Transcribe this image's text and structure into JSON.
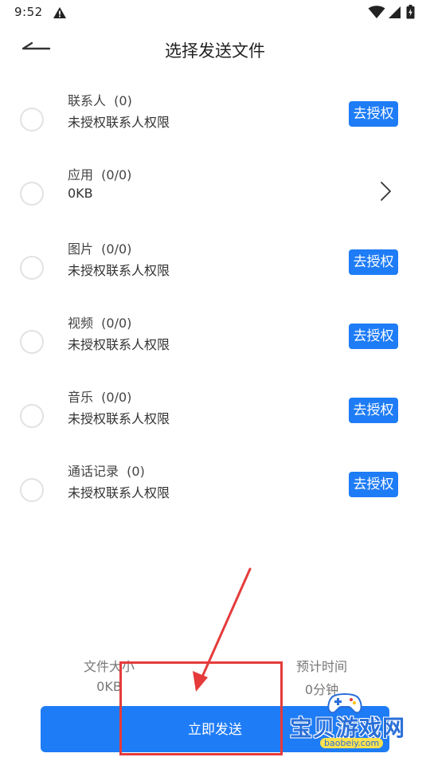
{
  "status_bar": {
    "time": "9:52",
    "icons": [
      "warning-icon",
      "wifi-icon",
      "signal-icon",
      "battery-icon"
    ]
  },
  "header": {
    "back_icon": "back-arrow-icon",
    "title": "选择发送文件"
  },
  "items": [
    {
      "title": "联系人  (0)",
      "subtitle": "未授权联系人权限",
      "action": "去授权"
    },
    {
      "title": "应用  (0/0)",
      "subtitle": "0KB",
      "action": "chevron-right-icon"
    },
    {
      "title": "图片  (0/0)",
      "subtitle": "未授权联系人权限",
      "action": "去授权"
    },
    {
      "title": "视频  (0/0)",
      "subtitle": "未授权联系人权限",
      "action": "去授权"
    },
    {
      "title": "音乐  (0/0)",
      "subtitle": "未授权联系人权限",
      "action": "去授权"
    },
    {
      "title": "通话记录  (0)",
      "subtitle": "未授权联系人权限",
      "action": "去授权"
    }
  ],
  "footer": {
    "file_size_label": "文件大小",
    "file_size_value": "0KB",
    "eta_label": "预计时间",
    "eta_value": "0分钟",
    "send_label": "立即发送"
  },
  "watermark": {
    "main": "宝贝游戏网",
    "sub": "baobeiy.com"
  },
  "colors": {
    "accent": "#1e7cf6",
    "annotation": "#e53b3b"
  }
}
